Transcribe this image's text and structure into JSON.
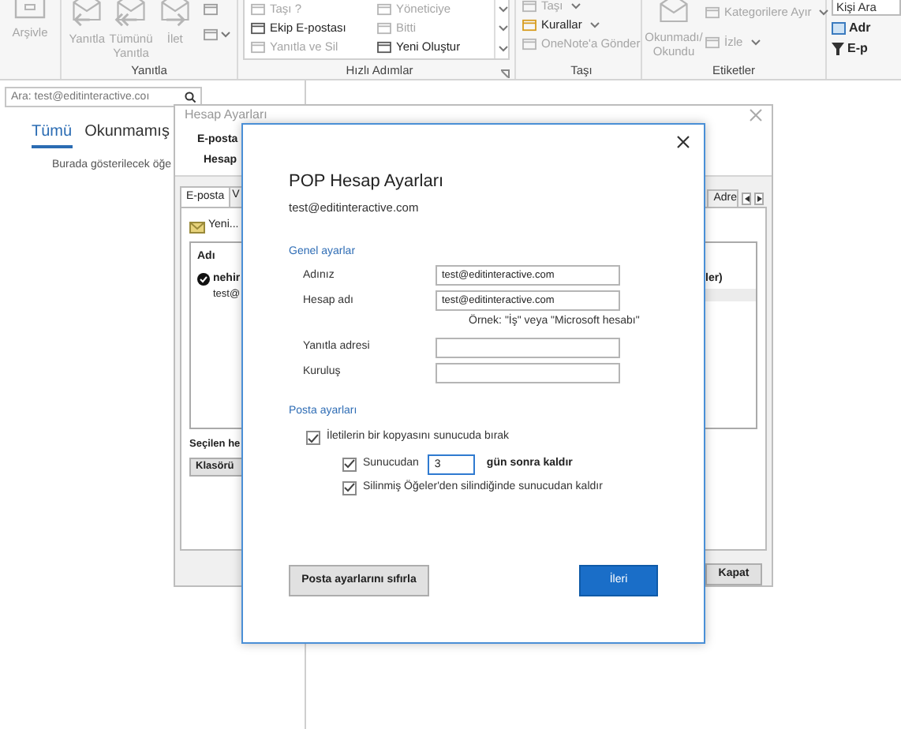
{
  "ribbon": {
    "archive": {
      "label": "Arşivle",
      "disabled": true
    },
    "respond": {
      "group_label": "Yanıtla",
      "buttons": [
        {
          "kind": "reply",
          "label": "Yanıtla",
          "disabled": true
        },
        {
          "kind": "reply_all",
          "label": "Tümünü Yanıtla",
          "disabled": true
        },
        {
          "kind": "forward",
          "label": "İlet",
          "disabled": true
        }
      ]
    },
    "quick_steps": {
      "group_label": "Hızlı Adımlar",
      "items": [
        {
          "label": "Taşı ?",
          "disabled": true
        },
        {
          "label": "Yöneticiye",
          "disabled": true
        },
        {
          "label": "Ekip E-postası",
          "disabled": false
        },
        {
          "label": "Bitti",
          "disabled": true
        },
        {
          "label": "Yanıtla ve Sil",
          "disabled": true
        },
        {
          "label": "Yeni Oluştur",
          "disabled": false
        }
      ]
    },
    "move": {
      "group_label": "Taşı",
      "items": [
        {
          "label": "Taşı",
          "dropdown": true,
          "disabled": true
        },
        {
          "label": "Kurallar",
          "dropdown": true,
          "disabled": false
        },
        {
          "label": "OneNote'a Gönder",
          "dropdown": false,
          "disabled": true
        }
      ]
    },
    "tags": {
      "group_label": "Etiketler",
      "read_button": {
        "label": "Okunmadı/ Okundu",
        "disabled": true
      },
      "items": [
        {
          "label": "Kategorilere Ayır",
          "dropdown": true,
          "disabled": true
        },
        {
          "label": "İzle",
          "dropdown": true,
          "disabled": true
        }
      ]
    },
    "find": {
      "search_value": "Kişi Ara",
      "items": [
        {
          "kind": "address",
          "label": "Adr"
        },
        {
          "kind": "filter",
          "label": "E-p"
        }
      ]
    }
  },
  "mail_list": {
    "search_placeholder": "Ara: test@editinteractive.coı",
    "tabs": [
      {
        "label": "Tümü",
        "selected": true
      },
      {
        "label": "Okunmamış",
        "selected": false
      }
    ],
    "empty_message": "Burada gösterilecek öğe"
  },
  "account_settings": {
    "title": "Hesap Ayarları",
    "heading": "E-posta",
    "subheading": "Hesap",
    "tabs": [
      {
        "label": "E-posta",
        "selected": true
      },
      {
        "label": "V",
        "selected": false
      }
    ],
    "right_tab": "Adre",
    "new_button": "Yeni...",
    "list": {
      "column": "Adı",
      "rows": [
        {
          "name": "nehir",
          "email": "test@",
          "default": true,
          "column_2": "ler)"
        }
      ]
    },
    "selected_account_label": "Seçilen he",
    "folder_button": "Klasörü",
    "close_button": "Kapat"
  },
  "pop_dialog": {
    "title": "POP Hesap Ayarları",
    "email": "test@editinteractive.com",
    "general": {
      "heading": "Genel ayarlar",
      "fields": [
        {
          "label": "Adınız",
          "value": "test@editinteractive.com"
        },
        {
          "label": "Hesap adı",
          "value": "test@editinteractive.com",
          "hint": "Örnek: \"İş\" veya \"Microsoft hesabı\""
        },
        {
          "label": "Yanıtla adresi"
        },
        {
          "label": "Kuruluş"
        }
      ]
    },
    "mail": {
      "heading": "Posta ayarları",
      "leave_copy": {
        "label": "İletilerin bir kopyasını sunucuda bırak",
        "checked": true
      },
      "remove_after": {
        "label": "Sunucudan",
        "checked": true,
        "days": "3",
        "suffix": "gün sonra kaldır"
      },
      "remove_deleted": {
        "label": "Silinmiş Öğeler'den silindiğinde sunucudan kaldır",
        "checked": true
      }
    },
    "reset_button": "Posta ayarlarını sıfırla",
    "next_button": "İleri"
  }
}
